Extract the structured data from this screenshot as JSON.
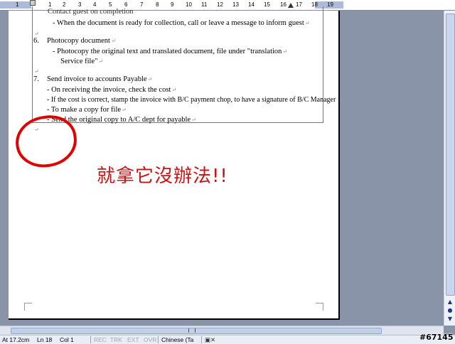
{
  "ruler": {
    "numbers": [
      "1",
      "1",
      "2",
      "3",
      "4",
      "5",
      "6",
      "7",
      "8",
      "9",
      "10",
      "11",
      "12",
      "13",
      "14",
      "15",
      "16",
      "17",
      "18",
      "19"
    ]
  },
  "document": {
    "lines": [
      "Contact guest on completion",
      "- When the document is ready for collection, call or leave a message to inform guest",
      "6.",
      "Photocopy document",
      "- Photocopy the original text and translated document, file under \"translation",
      "Service file\"",
      "7.",
      "Send invoice to accounts Payable",
      "- On receiving the invoice, check the cost",
      "- If the cost is correct, stamp the invoice with B/C payment chop, to have a signature of B/C Manager",
      "- To make a copy for file",
      "- Send the original copy to A/C dept for payable"
    ],
    "paragraph_mark": "↵"
  },
  "annotation": {
    "text": "就拿它沒辦法!!",
    "color": "#cc1111"
  },
  "status_bar": {
    "at": "At 17.2cm",
    "ln": "Ln 18",
    "col": "Col 1",
    "rec": "REC",
    "trk": "TRK",
    "ext": "EXT",
    "ovr": "OVR",
    "language": "Chinese (Ta"
  },
  "watermark": "#67145"
}
